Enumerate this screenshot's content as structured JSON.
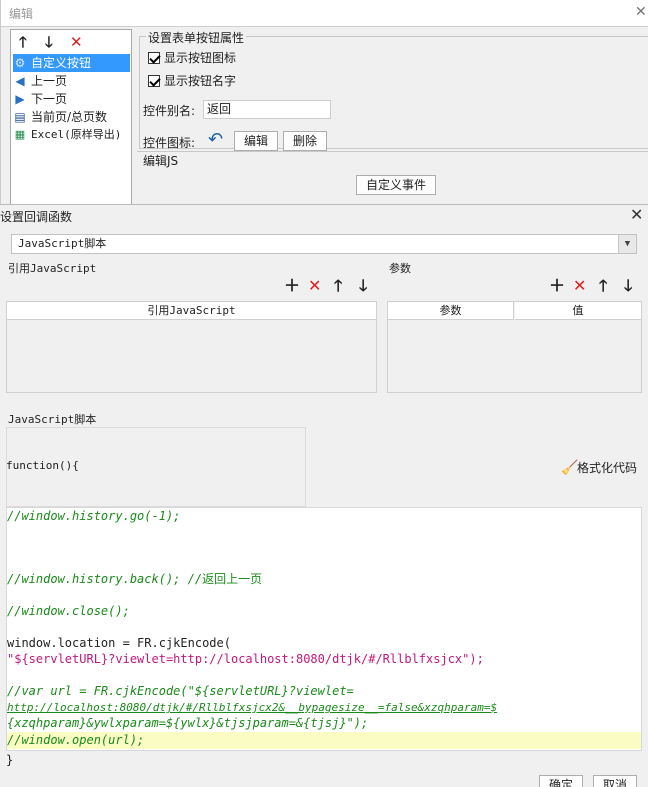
{
  "bg_window": {
    "title": "编辑",
    "tree_items": [
      {
        "label": "自定义按钮",
        "icon": "gear-icon",
        "selected": true
      },
      {
        "label": "上一页",
        "icon": "triangle-left-icon",
        "selected": false
      },
      {
        "label": "下一页",
        "icon": "triangle-right-icon",
        "selected": false
      },
      {
        "label": "当前页/总页数",
        "icon": "page-count-icon",
        "selected": false
      },
      {
        "label": "Excel(原样导出)",
        "icon": "excel-icon",
        "selected": false
      }
    ],
    "props": {
      "legend": "设置表单按钮属性",
      "show_icon_label": "显示按钮图标",
      "show_name_label": "显示按钮名字",
      "alias_label": "控件别名:",
      "alias_value": "返回",
      "icon_label": "控件图标:",
      "edit_button": "编辑",
      "delete_button": "删除"
    },
    "editjs_label": "编辑JS",
    "custom_event_button": "自定义事件"
  },
  "dialog": {
    "title": "设置回调函数",
    "type_select_value": "JavaScript脚本",
    "ref_section_label": "引用JavaScript",
    "ref_column_header": "引用JavaScript",
    "params_section_label": "参数",
    "params_columns": [
      "参数",
      "值"
    ],
    "script_section_label": "JavaScript脚本",
    "function_header": "function(){",
    "format_button": "格式化代码",
    "closing_brace": "}",
    "ok_button": "确定",
    "cancel_button": "取消",
    "code": {
      "line1": "//window.history.go(-1);",
      "line2a": "//window.history.back(); //",
      "line2b": "返回上一页",
      "line3": "//window.close();",
      "line4": "window.location = FR.cjkEncode(",
      "line5": "\"${servletURL}?viewlet=http://localhost:8080/dtjk/#/Rllblfxsjcx\");",
      "line6": "//var url = FR.cjkEncode(\"${servletURL}?viewlet=",
      "line7": "http://localhost:8080/dtjk/#/Rllblfxsjcx2&__bypagesize__=false&xzqhparam=$",
      "line8": "{xzqhparam}&ywlxparam=${ywlx}&tjsjparam=&{tjsj}\");",
      "line9": "//window.open(url);"
    }
  }
}
